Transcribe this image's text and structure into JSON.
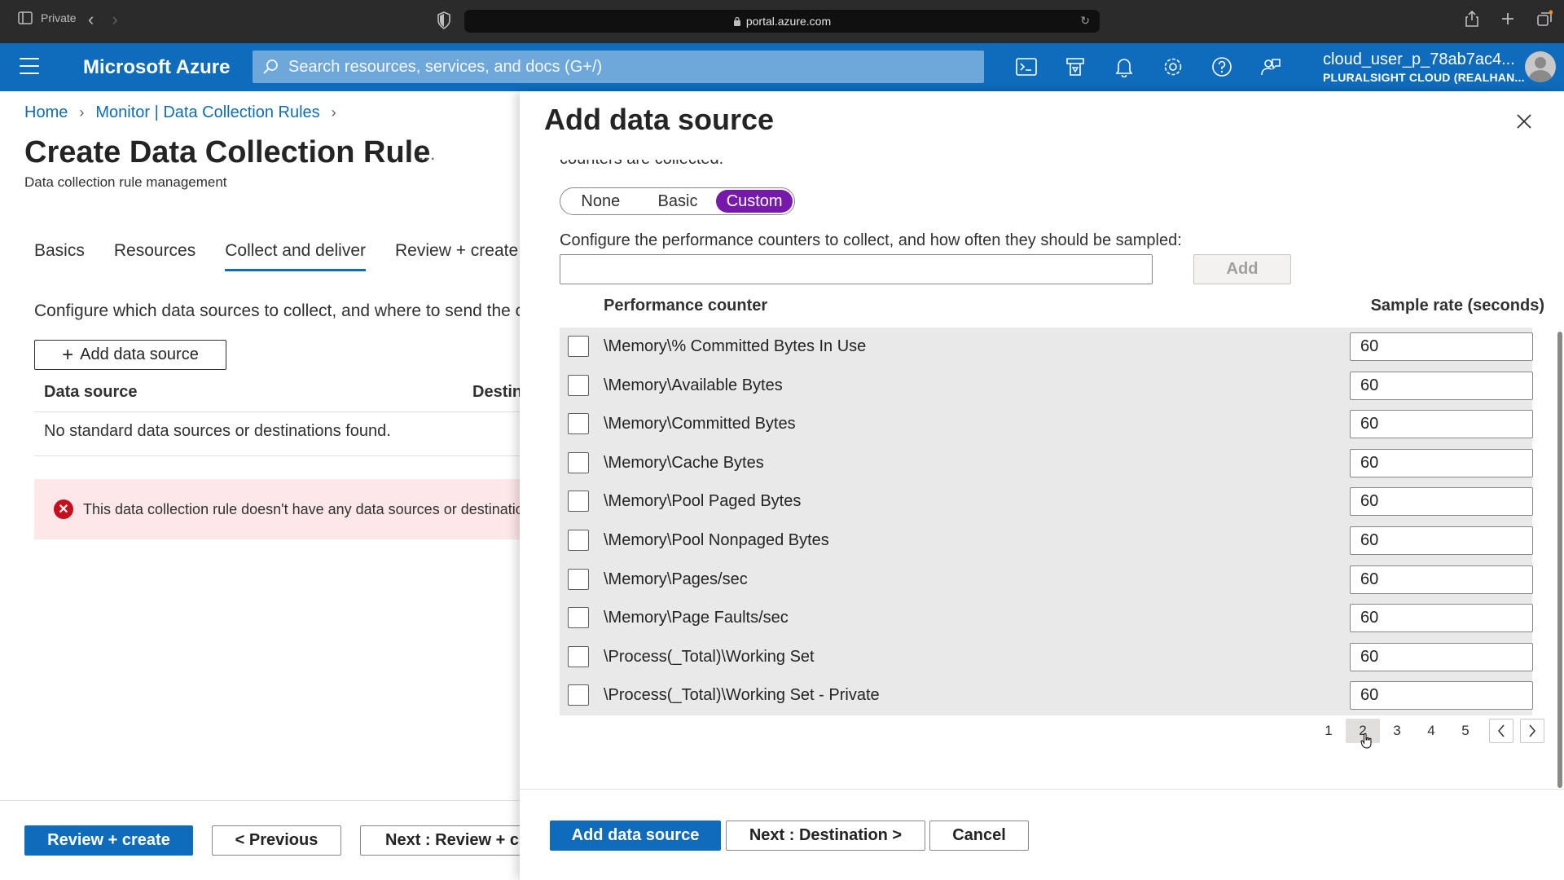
{
  "browser": {
    "private_label": "Private",
    "url": "portal.azure.com"
  },
  "topnav": {
    "brand": "Microsoft Azure",
    "search_placeholder": "Search resources, services, and docs (G+/)",
    "account_user": "cloud_user_p_78ab7ac4...",
    "account_tenant": "PLURALSIGHT CLOUD (REALHAN..."
  },
  "breadcrumb": {
    "home": "Home",
    "parent": "Monitor | Data Collection Rules"
  },
  "page": {
    "title": "Create Data Collection Rule",
    "more": "...",
    "subtitle": "Data collection rule management",
    "tabs": [
      {
        "label": "Basics"
      },
      {
        "label": "Resources"
      },
      {
        "label": "Collect and deliver"
      },
      {
        "label": "Review + create"
      }
    ],
    "active_tab": "Collect and deliver",
    "config_text": "Configure which data sources to collect, and where to send the c",
    "add_data_source_label": "Add data source",
    "table_headers": {
      "data_source": "Data source",
      "destination": "Destin"
    },
    "empty_text": "No standard data sources or destinations found.",
    "error_text": "This data collection rule doesn't have any data sources or destinatio"
  },
  "left_footer": {
    "review_create": "Review + create",
    "previous": "< Previous",
    "next": "Next : Review + cr"
  },
  "panel": {
    "title": "Add data source",
    "cut_text": "counters are collected.",
    "pills": [
      {
        "label": "None"
      },
      {
        "label": "Basic"
      },
      {
        "label": "Custom"
      }
    ],
    "selected_pill": "Custom",
    "config_text": "Configure the performance counters to collect, and how often they should be sampled:",
    "counter_input_value": "",
    "add_label": "Add",
    "header_counter": "Performance counter",
    "header_rate": "Sample rate (seconds)",
    "rows": [
      {
        "counter": "\\Memory\\% Committed Bytes In Use",
        "rate": "60",
        "checked": false
      },
      {
        "counter": "\\Memory\\Available Bytes",
        "rate": "60",
        "checked": false
      },
      {
        "counter": "\\Memory\\Committed Bytes",
        "rate": "60",
        "checked": false
      },
      {
        "counter": "\\Memory\\Cache Bytes",
        "rate": "60",
        "checked": false
      },
      {
        "counter": "\\Memory\\Pool Paged Bytes",
        "rate": "60",
        "checked": false
      },
      {
        "counter": "\\Memory\\Pool Nonpaged Bytes",
        "rate": "60",
        "checked": false
      },
      {
        "counter": "\\Memory\\Pages/sec",
        "rate": "60",
        "checked": false
      },
      {
        "counter": "\\Memory\\Page Faults/sec",
        "rate": "60",
        "checked": false
      },
      {
        "counter": "\\Process(_Total)\\Working Set",
        "rate": "60",
        "checked": false
      },
      {
        "counter": "\\Process(_Total)\\Working Set - Private",
        "rate": "60",
        "checked": false
      }
    ],
    "pages": [
      "1",
      "2",
      "3",
      "4",
      "5"
    ],
    "current_page": "2",
    "footer": {
      "add_data_source": "Add data source",
      "next_destination": "Next : Destination >",
      "cancel": "Cancel"
    }
  },
  "colors": {
    "azure_blue": "#0f6cbd",
    "custom_pill": "#7719aa",
    "error_bg": "#fde7e9",
    "error_icon": "#c50f1f"
  }
}
